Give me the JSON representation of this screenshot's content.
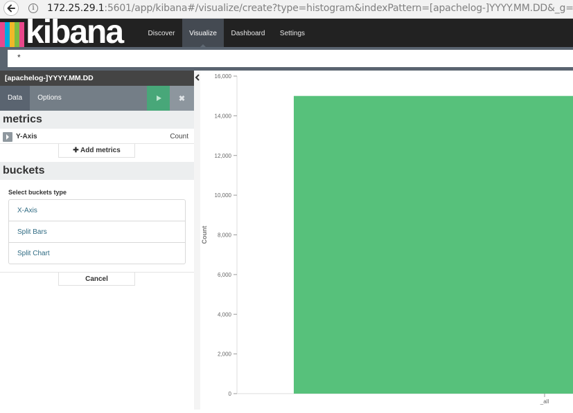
{
  "browser": {
    "url_host": "172.25.29.1",
    "url_rest": ":5601/app/kibana#/visualize/create?type=histogram&indexPattern=[apachelog-]YYYY.MM.DD&_g=(re"
  },
  "app": {
    "logo_text": "kibana",
    "nav": [
      "Discover",
      "Visualize",
      "Dashboard",
      "Settings"
    ],
    "active_nav": "Visualize"
  },
  "query": {
    "value": "*"
  },
  "sidebar": {
    "index_pattern": "[apachelog-]YYYY.MM.DD",
    "tabs": {
      "data": "Data",
      "options": "Options"
    },
    "metrics": {
      "title": "metrics",
      "y_axis_label": "Y-Axis",
      "y_axis_value": "Count",
      "add_label": "Add metrics"
    },
    "buckets": {
      "title": "buckets",
      "select_label": "Select buckets type",
      "types": [
        "X-Axis",
        "Split Bars",
        "Split Chart"
      ],
      "cancel_label": "Cancel"
    }
  },
  "chart_data": {
    "type": "bar",
    "categories": [
      "_all"
    ],
    "values": [
      15000
    ],
    "ylabel": "Count",
    "ylim": [
      0,
      16000
    ],
    "yticks": [
      0,
      2000,
      4000,
      6000,
      8000,
      10000,
      12000,
      14000,
      16000
    ],
    "ytick_labels": [
      "0",
      "2,000",
      "4,000",
      "6,000",
      "8,000",
      "10,000",
      "12,000",
      "14,000",
      "16,000"
    ],
    "bar_color": "#57c17b",
    "grid": false
  },
  "colors": {
    "nav_bg": "#222222",
    "nav_active": "#444a52",
    "accent_green": "#48a779",
    "logo_bars": [
      "#e8488b",
      "#00a9e0",
      "#f0b829",
      "#7dbd42",
      "#25b2a1"
    ]
  }
}
